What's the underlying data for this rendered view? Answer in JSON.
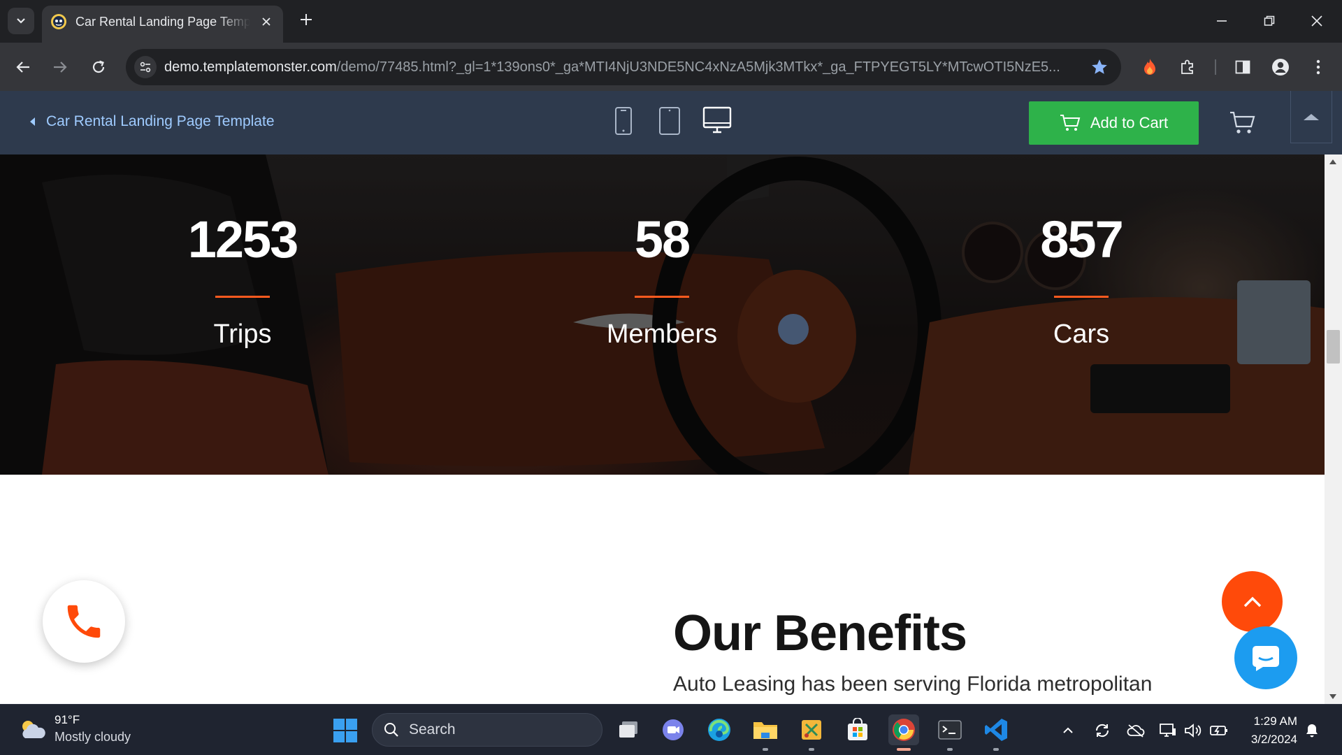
{
  "browser": {
    "tab": {
      "title": "Car Rental Landing Page Template"
    },
    "omnibox": {
      "url_host": "demo.templatemonster.com",
      "url_rest": "/demo/77485.html?_gl=1*139ons0*_ga*MTI4NjU3NDE5NC4xNzA5Mjk3MTkx*_ga_FTPYEGT5LY*MTcwOTI5NzE5..."
    }
  },
  "tm_bar": {
    "back_label": "Car Rental Landing Page Template",
    "add_to_cart": "Add to Cart",
    "devices": [
      "mobile-icon",
      "tablet-icon",
      "desktop-icon"
    ],
    "active_device": "desktop",
    "colors": {
      "bar": "#2e3a4d",
      "button": "#2eb24a",
      "link": "#9fcbff"
    }
  },
  "page": {
    "stats": [
      {
        "number": "1253",
        "label": "Trips"
      },
      {
        "number": "58",
        "label": "Members"
      },
      {
        "number": "857",
        "label": "Cars"
      }
    ],
    "benefits": {
      "title": "Our Benefits",
      "text": "Auto Leasing has been serving Florida metropolitan area for over eighteen years"
    },
    "colors": {
      "accent": "#ff4a0a",
      "chat": "#1c9cf0"
    }
  },
  "taskbar": {
    "weather": {
      "temp": "91°F",
      "condition": "Mostly cloudy"
    },
    "search_label": "Search",
    "clock": {
      "time": "1:29 AM",
      "date": "3/2/2024"
    },
    "apps": [
      "task-view-icon",
      "teams-icon",
      "edge-icon",
      "file-explorer-icon",
      "snipping-icon",
      "store-icon",
      "chrome-icon",
      "terminal-icon",
      "vscode-icon"
    ],
    "active_app": "chrome"
  }
}
